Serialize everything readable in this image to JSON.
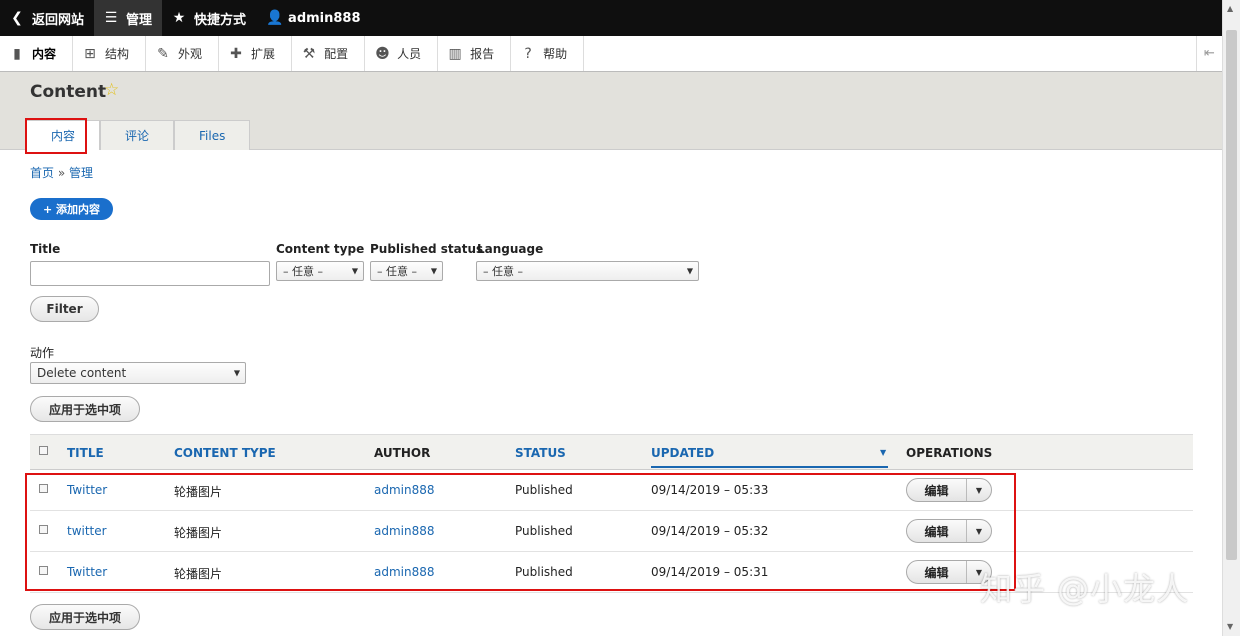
{
  "toolbar": {
    "back": {
      "label": "返回网站",
      "icon": "chevron-left-icon"
    },
    "manage": {
      "label": "管理",
      "icon": "menu-icon"
    },
    "shortcuts": {
      "label": "快捷方式",
      "icon": "star-icon"
    },
    "user": {
      "label": "admin888",
      "icon": "user-icon"
    }
  },
  "admin_menu": [
    {
      "label": "内容",
      "icon": "file-icon"
    },
    {
      "label": "结构",
      "icon": "structure-icon"
    },
    {
      "label": "外观",
      "icon": "brush-icon"
    },
    {
      "label": "扩展",
      "icon": "puzzle-icon"
    },
    {
      "label": "配置",
      "icon": "wrench-icon"
    },
    {
      "label": "人员",
      "icon": "people-icon"
    },
    {
      "label": "报告",
      "icon": "chart-icon"
    },
    {
      "label": "帮助",
      "icon": "help-icon"
    }
  ],
  "page": {
    "title": "Content",
    "tabs": [
      {
        "label": "内容"
      },
      {
        "label": "评论"
      },
      {
        "label": "Files"
      }
    ],
    "breadcrumb": {
      "home": "首页",
      "sep": "»",
      "current": "管理"
    },
    "add_button": "+ 添加内容"
  },
  "filters": {
    "title_label": "Title",
    "title_value": "",
    "content_type_label": "Content type",
    "content_type_value": "– 任意 –",
    "published_label": "Published status",
    "published_value": "– 任意 –",
    "language_label": "Language",
    "language_value": "– 任意 –",
    "filter_button": "Filter"
  },
  "bulk": {
    "action_label": "动作",
    "action_value": "Delete content",
    "apply_button": "应用于选中项"
  },
  "table": {
    "columns": {
      "title": "TITLE",
      "content_type": "CONTENT TYPE",
      "author": "AUTHOR",
      "status": "STATUS",
      "updated": "UPDATED",
      "operations": "OPERATIONS"
    },
    "rows": [
      {
        "title": "Twitter",
        "type": "轮播图片",
        "author": "admin888",
        "status": "Published",
        "updated": "09/14/2019 – 05:33",
        "op": "编辑"
      },
      {
        "title": "twitter",
        "type": "轮播图片",
        "author": "admin888",
        "status": "Published",
        "updated": "09/14/2019 – 05:32",
        "op": "编辑"
      },
      {
        "title": "Twitter",
        "type": "轮播图片",
        "author": "admin888",
        "status": "Published",
        "updated": "09/14/2019 – 05:31",
        "op": "编辑"
      }
    ]
  },
  "watermark": "知乎 @小龙人"
}
